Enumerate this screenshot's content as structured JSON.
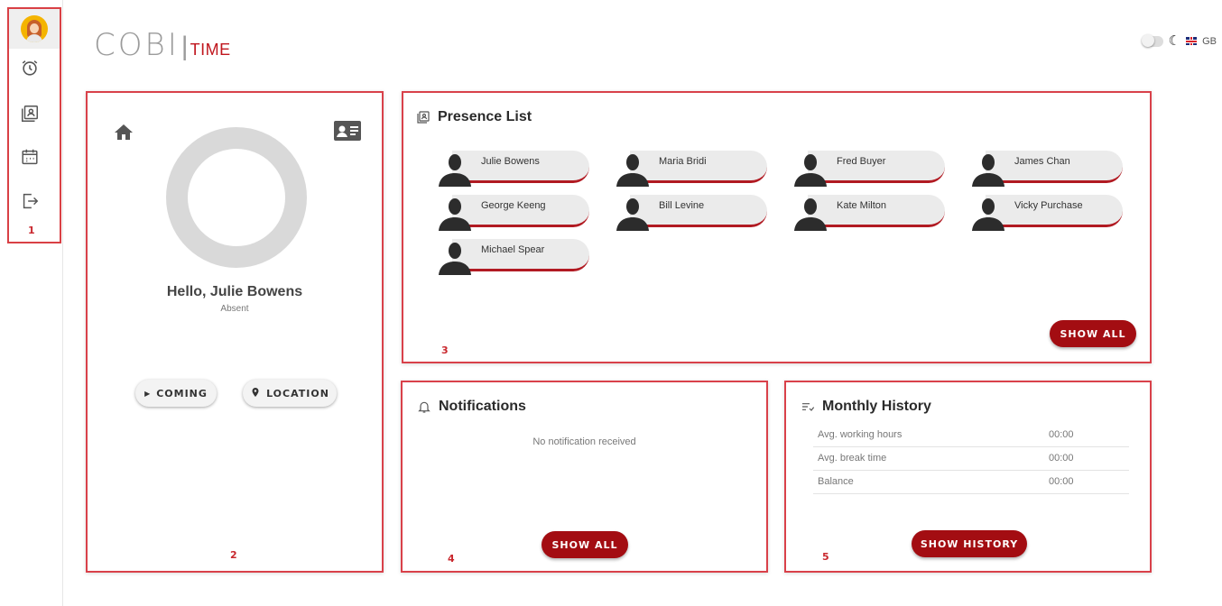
{
  "app": {
    "logo_main": "COBI",
    "logo_sub": "TIME",
    "language": "GB"
  },
  "sidebar": {
    "items": [
      {
        "name": "profile-avatar"
      },
      {
        "name": "alarm-clock-icon"
      },
      {
        "name": "contacts-list-icon"
      },
      {
        "name": "calendar-icon"
      },
      {
        "name": "logout-icon"
      }
    ],
    "frame_number": "1"
  },
  "profile": {
    "greeting": "Hello, Julie Bowens",
    "status": "Absent",
    "coming_label": "COMING",
    "location_label": "LOCATION",
    "frame_number": "2"
  },
  "presence": {
    "title": "Presence List",
    "people": [
      "Julie Bowens",
      "Maria Bridi",
      "Fred Buyer",
      "James Chan",
      "George Keeng",
      "Bill Levine",
      "Kate Milton",
      "Vicky Purchase",
      "Michael Spear"
    ],
    "show_all_label": "SHOW ALL",
    "frame_number": "3"
  },
  "notifications": {
    "title": "Notifications",
    "empty_text": "No notification received",
    "show_all_label": "SHOW ALL",
    "frame_number": "4"
  },
  "history": {
    "title": "Monthly History",
    "rows": [
      {
        "label": "Avg. working hours",
        "value": "00:00"
      },
      {
        "label": "Avg. break time",
        "value": "00:00"
      },
      {
        "label": "Balance",
        "value": "00:00"
      }
    ],
    "show_history_label": "SHOW HISTORY",
    "frame_number": "5"
  },
  "colors": {
    "accent": "#a30d12",
    "frame": "#d9414a",
    "logo_grey": "#9b9b9b"
  }
}
